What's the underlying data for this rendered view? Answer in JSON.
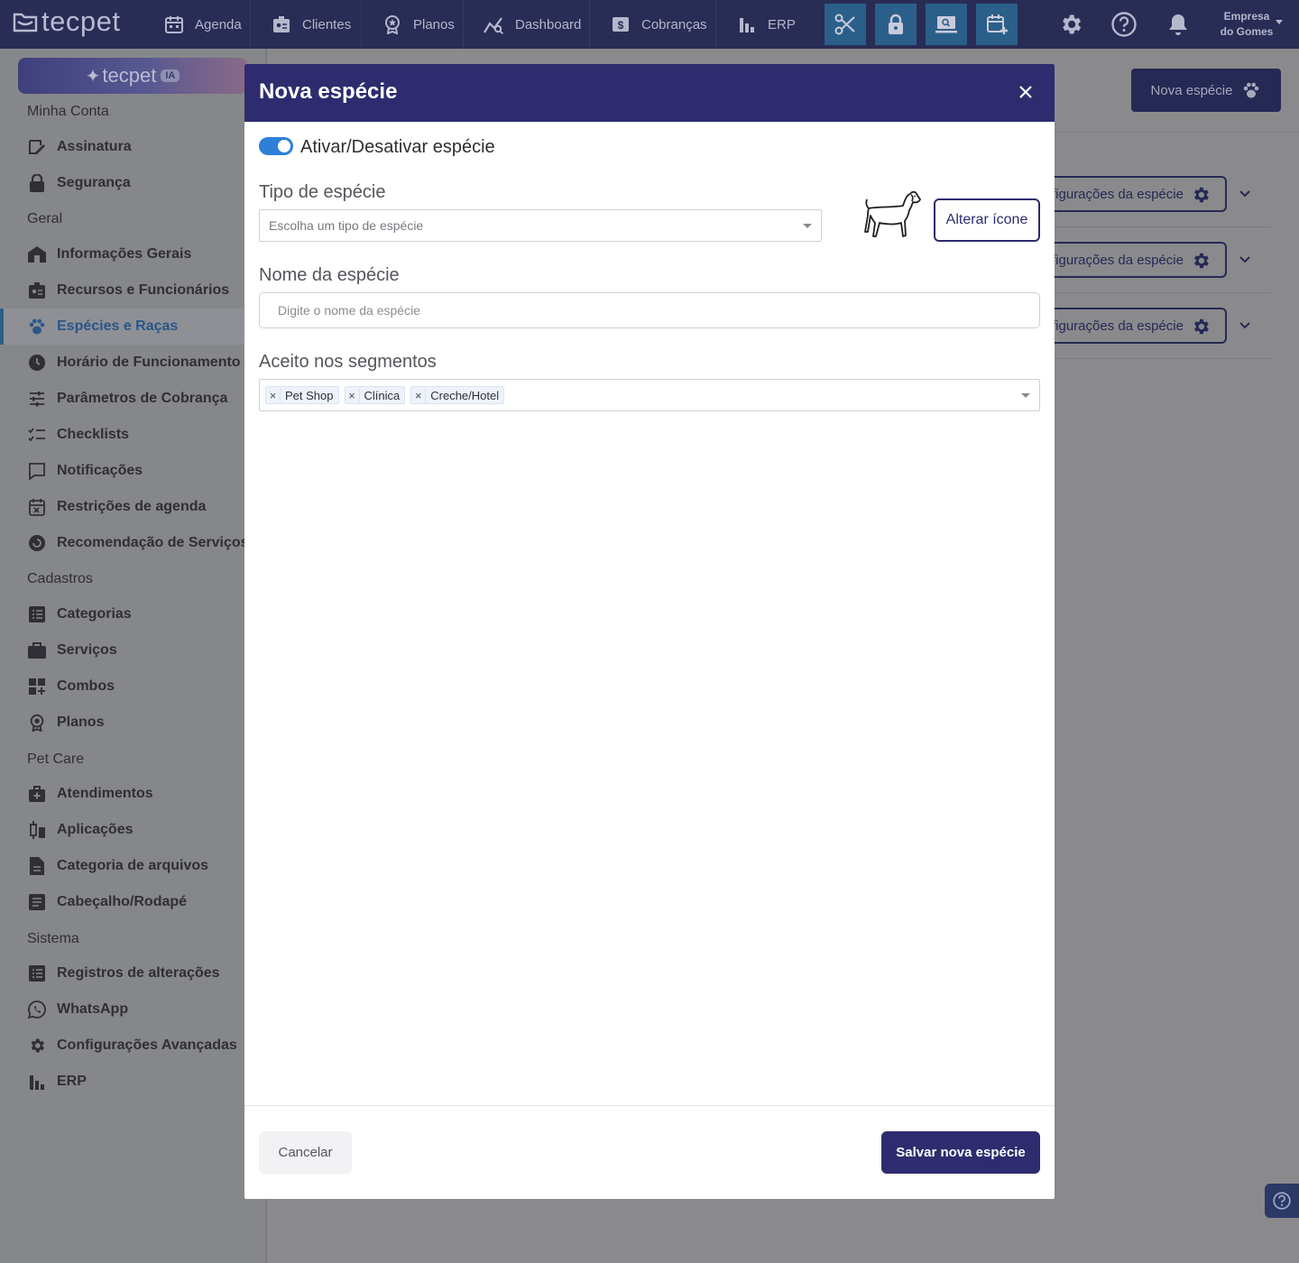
{
  "topbar": {
    "logo": "tecpet",
    "nav": [
      {
        "label": "Agenda",
        "icon": "calendar-icon"
      },
      {
        "label": "Clientes",
        "icon": "id-card-icon"
      },
      {
        "label": "Planos",
        "icon": "badge-icon"
      },
      {
        "label": "Dashboard",
        "icon": "chart-line-icon"
      },
      {
        "label": "Cobranças",
        "icon": "dollar-icon"
      },
      {
        "label": "ERP",
        "icon": "bar-chart-icon"
      }
    ],
    "tools": [
      "scissors-icon",
      "lock-icon",
      "screen-search-icon",
      "calendar-plus-icon"
    ],
    "company_line1": "Empresa",
    "company_line2": "do Gomes"
  },
  "sidebar": {
    "ia_label": "tecpet",
    "ia_tag": "IA",
    "sections": {
      "minha_conta": "Minha Conta",
      "geral": "Geral",
      "cadastros": "Cadastros",
      "pet_care": "Pet Care",
      "sistema": "Sistema"
    },
    "items": [
      {
        "label": "Assinatura",
        "icon": "signature-icon"
      },
      {
        "label": "Segurança",
        "icon": "lock-icon"
      },
      {
        "label": "Informações Gerais",
        "icon": "store-icon"
      },
      {
        "label": "Recursos e Funcionários",
        "icon": "id-card-icon"
      },
      {
        "label": "Espécies e Raças",
        "icon": "paw-icon",
        "active": true
      },
      {
        "label": "Horário de Funcionamento",
        "icon": "clock-icon"
      },
      {
        "label": "Parâmetros de Cobrança",
        "icon": "sliders-icon"
      },
      {
        "label": "Checklists",
        "icon": "checklist-icon"
      },
      {
        "label": "Notificações",
        "icon": "message-icon"
      },
      {
        "label": "Restrições de agenda",
        "icon": "calendar-x-icon"
      },
      {
        "label": "Recomendação de Serviços",
        "icon": "circle-arrow-icon"
      },
      {
        "label": "Categorias",
        "icon": "list-icon"
      },
      {
        "label": "Serviços",
        "icon": "briefcase-icon"
      },
      {
        "label": "Combos",
        "icon": "grid-plus-icon"
      },
      {
        "label": "Planos",
        "icon": "badge-icon"
      },
      {
        "label": "Atendimentos",
        "icon": "medical-bag-icon"
      },
      {
        "label": "Aplicações",
        "icon": "syringe-icon"
      },
      {
        "label": "Categoria de arquivos",
        "icon": "file-icon"
      },
      {
        "label": "Cabeçalho/Rodapé",
        "icon": "document-icon"
      },
      {
        "label": "Registros de alterações",
        "icon": "list-icon"
      },
      {
        "label": "WhatsApp",
        "icon": "whatsapp-icon"
      },
      {
        "label": "Configurações Avançadas",
        "icon": "gear-icon"
      },
      {
        "label": "ERP",
        "icon": "bar-chart-icon"
      }
    ]
  },
  "background": {
    "new_species_label": "Nova espécie",
    "config_label": "figurações da espécie"
  },
  "modal": {
    "title": "Nova espécie",
    "toggle_label": "Ativar/Desativar espécie",
    "toggle_on": true,
    "type_label": "Tipo de espécie",
    "type_placeholder": "Escolha um tipo de espécie",
    "change_icon_label": "Alterar ícone",
    "name_label": "Nome da espécie",
    "name_placeholder": "Digite o nome da espécie",
    "segments_label": "Aceito nos segmentos",
    "segments": [
      "Pet Shop",
      "Clínica",
      "Creche/Hotel"
    ],
    "cancel_label": "Cancelar",
    "save_label": "Salvar nova espécie"
  },
  "colors": {
    "topbar": "#292c55",
    "primary": "#2e2c6e",
    "toggle": "#2f7fd8",
    "tool_button": "#2a5f8a"
  }
}
